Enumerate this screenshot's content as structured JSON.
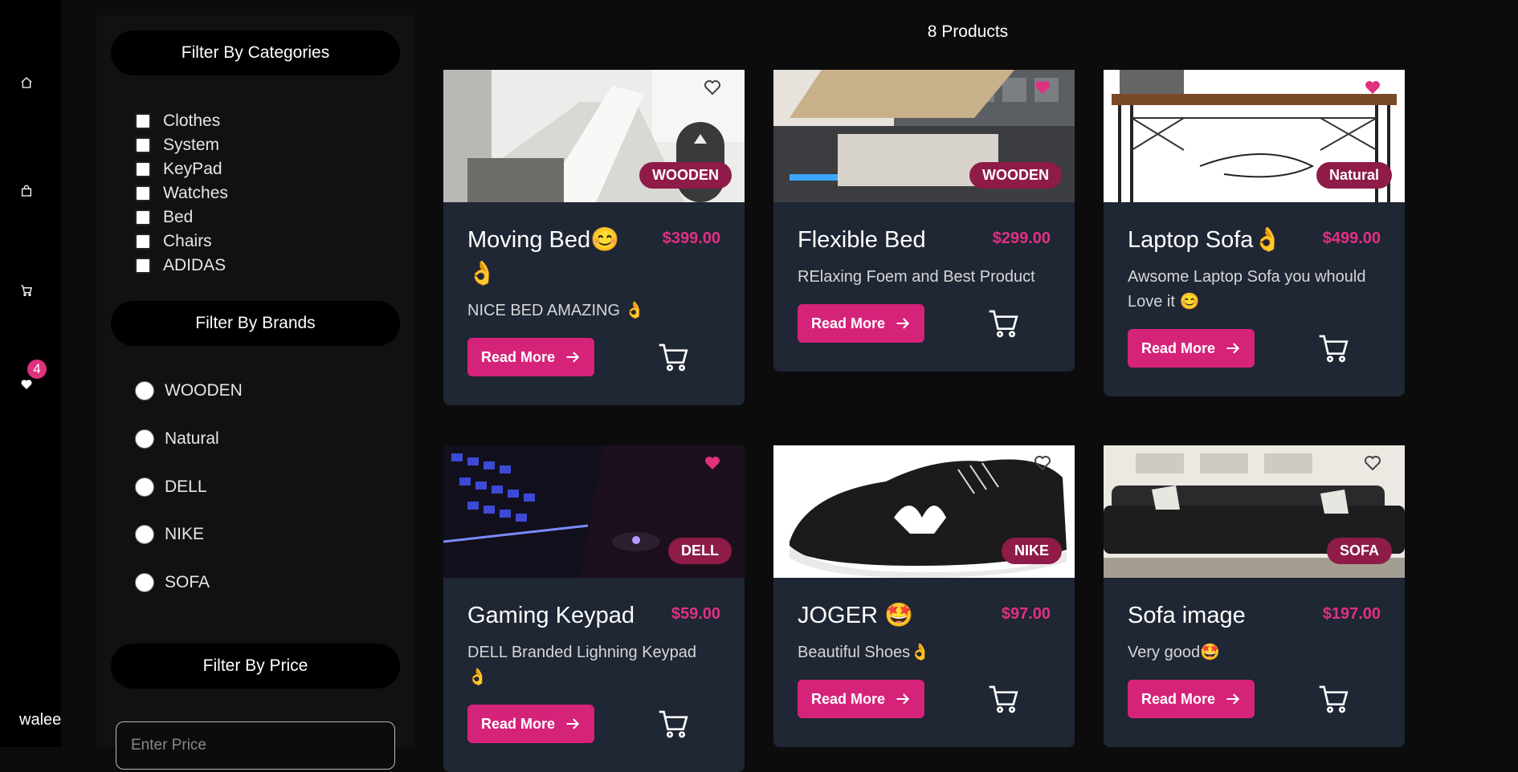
{
  "rail": {
    "items": [
      {
        "icon": "home-icon"
      },
      {
        "icon": "bag-icon"
      },
      {
        "icon": "cart-icon"
      },
      {
        "icon": "heart-icon",
        "badge": "4"
      }
    ],
    "user": "waleed"
  },
  "filters": {
    "categories_title": "Filter By Categories",
    "categories": [
      "Clothes",
      "System",
      "KeyPad",
      "Watches",
      "Bed",
      "Chairs",
      "ADIDAS"
    ],
    "brands_title": "Filter By Brands",
    "brands": [
      "WOODEN",
      "Natural",
      "DELL",
      "NIKE",
      "SOFA"
    ],
    "price_title": "Filter By Price",
    "price_placeholder": "Enter Price"
  },
  "products_count": "8 Products",
  "read_more_label": "Read More",
  "products": [
    {
      "title": "Moving Bed😊👌",
      "price": "$399.00",
      "desc": "NICE BED AMAZING 👌",
      "brand": "WOODEN",
      "favorite": false
    },
    {
      "title": "Flexible Bed",
      "price": "$299.00",
      "desc": "RElaxing Foem and Best Product",
      "brand": "WOODEN",
      "favorite": true
    },
    {
      "title": "Laptop Sofa👌",
      "price": "$499.00",
      "desc": "Awsome Laptop Sofa you whould Love it 😊",
      "brand": "Natural",
      "favorite": true
    },
    {
      "title": "Gaming Keypad",
      "price": "$59.00",
      "desc": "DELL Branded Lighning Keypad 👌",
      "brand": "DELL",
      "favorite": true
    },
    {
      "title": "JOGER 🤩",
      "price": "$97.00",
      "desc": "Beautiful Shoes👌",
      "brand": "NIKE",
      "favorite": false
    },
    {
      "title": "Sofa image",
      "price": "$197.00",
      "desc": "Very good🤩",
      "brand": "SOFA",
      "favorite": false
    }
  ],
  "colors": {
    "accent": "#d6237a",
    "price": "#e0317f",
    "card": "#1f2634",
    "tag": "#8e1b48"
  }
}
